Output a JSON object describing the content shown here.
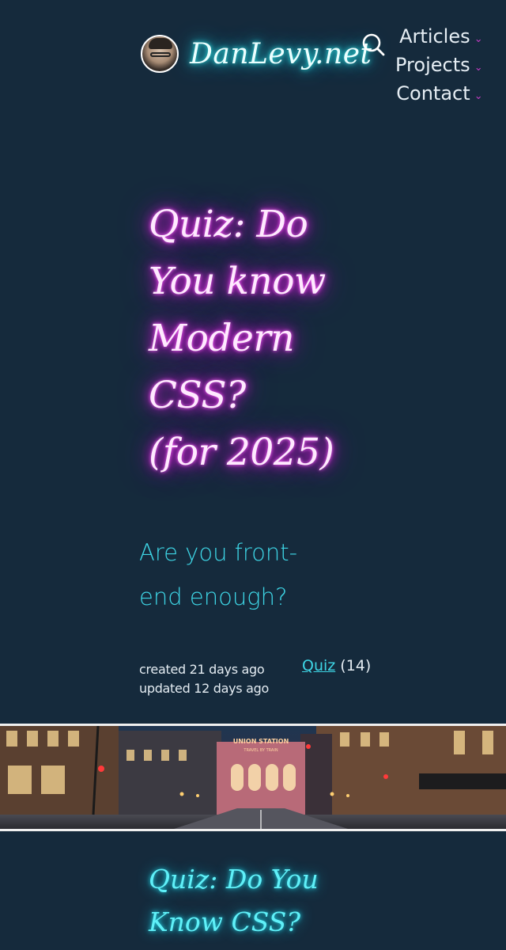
{
  "header": {
    "site_name": "DanLevy.net",
    "nav": [
      {
        "label": "Articles"
      },
      {
        "label": "Projects"
      },
      {
        "label": "Contact"
      }
    ]
  },
  "post": {
    "title_lines": [
      "Quiz: Do",
      "You know",
      "Modern",
      "CSS?",
      "(for 2025)"
    ],
    "subtitle_lines": [
      "Are you front-",
      "end enough?"
    ],
    "created": "created 21 days ago",
    "updated": "updated 12 days ago",
    "category": "Quiz",
    "category_count": "(14)"
  },
  "hero": {
    "sign_line1": "UNION STATION",
    "sign_line2": "TRAVEL BY TRAIN"
  },
  "related": {
    "title_lines": [
      "Quiz: Do You",
      "Know CSS?"
    ]
  },
  "colors": {
    "background": "#152a3c",
    "accent_cyan": "#3ed6e6",
    "accent_magenta": "#e020e0",
    "nav_caret": "#c43bc4"
  },
  "icons": [
    "avatar",
    "search-icon",
    "chevron-down-icon"
  ]
}
